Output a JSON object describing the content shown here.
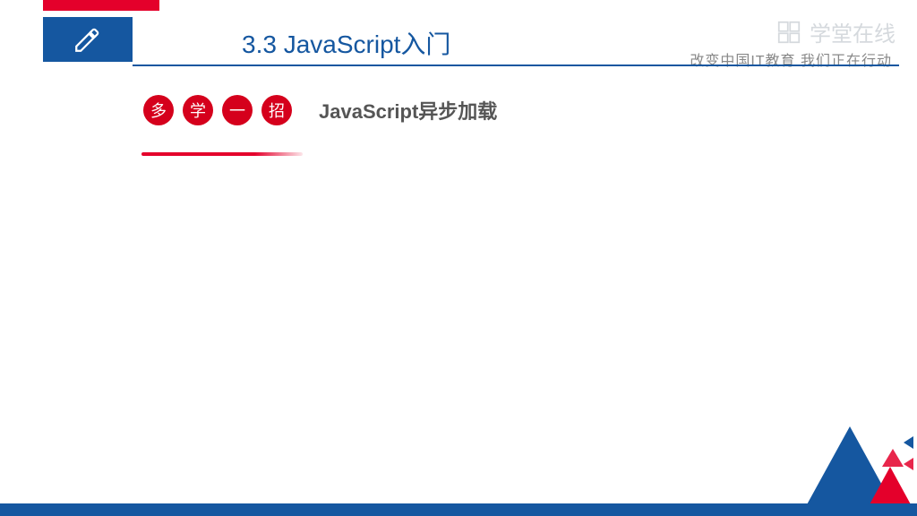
{
  "header": {
    "title": "3.3 JavaScript入门",
    "subtitle_right": "改变中国IT教育 我们正在行动"
  },
  "watermark": {
    "brand": "学堂在线"
  },
  "badges": [
    "多",
    "学",
    "一",
    "招"
  ],
  "section": {
    "label": "JavaScript异步加载"
  },
  "colors": {
    "primary_blue": "#1557a0",
    "accent_red": "#e4002b"
  }
}
